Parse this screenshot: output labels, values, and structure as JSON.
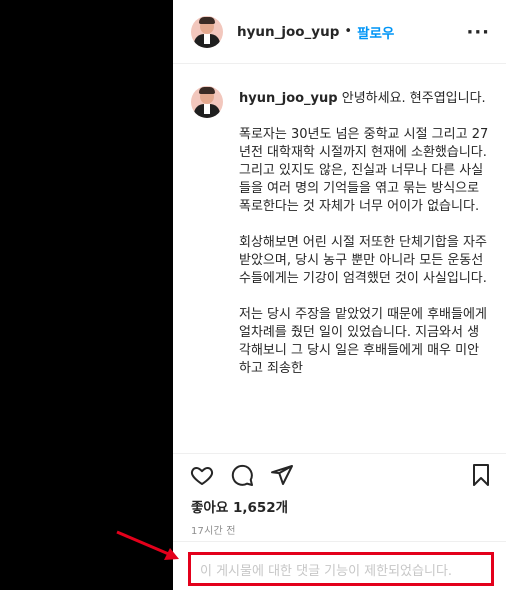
{
  "header": {
    "username": "hyun_joo_yup",
    "separator": "•",
    "follow_label": "팔로우",
    "more_label": "···",
    "more_icon": "more-horizontal-icon"
  },
  "caption": {
    "username": "hyun_joo_yup",
    "first_line": "안녕하세요. 현주엽입니다.",
    "paragraphs": [
      "폭로자는 30년도 넘은 중학교 시절 그리고 27년전 대학재학 시절까지 현재에 소환했습니다. 그리고 있지도 않은, 진실과 너무나 다른 사실들을 여러 명의 기억들을 엮고 묶는 방식으로 폭로한다는 것 자체가 너무 어이가 없습니다.",
      "회상해보면 어린 시절 저또한 단체기합을 자주 받았으며, 당시 농구 뿐만 아니라 모든 운동선수들에게는 기강이 엄격했던 것이 사실입니다.",
      "저는 당시 주장을 맡았었기 때문에 후배들에게 얼차례를 줬던 일이 있었습니다. 지금와서 생각해보니 그 당시 일은 후배들에게 매우 미안하고 죄송한"
    ]
  },
  "actions": {
    "like_icon": "heart-icon",
    "comment_icon": "comment-icon",
    "share_icon": "paper-plane-icon",
    "save_icon": "bookmark-icon"
  },
  "likes_text": "좋아요 1,652개",
  "timestamp": "17시간 전",
  "comments_disabled_text": "이 게시물에 대한 댓글 기능이 제한되었습니다.",
  "colors": {
    "link_blue": "#0095f6",
    "highlight_red": "#e3001b",
    "text": "#262626",
    "muted": "#8e8e8e"
  }
}
